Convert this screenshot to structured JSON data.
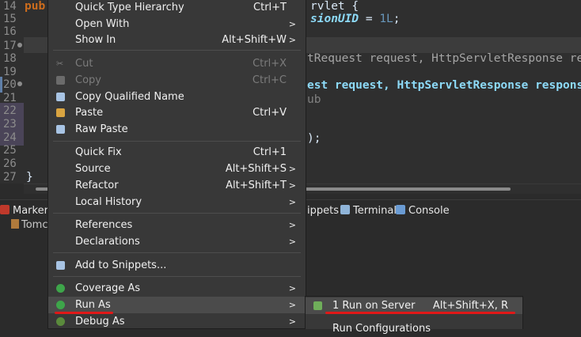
{
  "editor": {
    "gutter": [
      "14",
      "15",
      "16",
      "17",
      "18",
      "19",
      "20",
      "21",
      "22",
      "23",
      "24",
      "25",
      "26",
      "27"
    ],
    "code_lines": {
      "l14_kw": "pub",
      "l14_right": "rvlet {",
      "l15_field": "sionUID",
      "l15_rest": " = ",
      "l15_num": "1L",
      "l15_end": ";",
      "l18_text": "tRequest request, HttpServletResponse re",
      "l20_text": "est request, HttpServletResponse respons",
      "l21_text": "ub",
      "l24_text": ");",
      "l27_text": "}"
    }
  },
  "panel": {
    "tabs": [
      {
        "label": "Markers",
        "icon": "markers-icon"
      },
      {
        "label": "ippets",
        "icon": "snippets-icon"
      },
      {
        "label": "Terminal",
        "icon": "terminal-icon"
      },
      {
        "label": "Console",
        "icon": "console-icon"
      }
    ],
    "tree_item": "Tomc"
  },
  "context_menu": {
    "items": [
      {
        "label": "Quick Type Hierarchy",
        "accel": "Ctrl+T",
        "submenu": false,
        "disabled": false,
        "icon": ""
      },
      {
        "label": "Open With",
        "accel": "",
        "submenu": true,
        "disabled": false,
        "icon": ""
      },
      {
        "label": "Show In",
        "accel": "Alt+Shift+W",
        "submenu": true,
        "disabled": false,
        "icon": ""
      },
      {
        "label": "Cut",
        "accel": "Ctrl+X",
        "submenu": false,
        "disabled": true,
        "icon": "scissors-icon"
      },
      {
        "label": "Copy",
        "accel": "Ctrl+C",
        "submenu": false,
        "disabled": true,
        "icon": "copy-icon"
      },
      {
        "label": "Copy Qualified Name",
        "accel": "",
        "submenu": false,
        "disabled": false,
        "icon": "copy-qualified-icon"
      },
      {
        "label": "Paste",
        "accel": "Ctrl+V",
        "submenu": false,
        "disabled": false,
        "icon": "paste-icon"
      },
      {
        "label": "Raw Paste",
        "accel": "",
        "submenu": false,
        "disabled": false,
        "icon": "raw-paste-icon"
      },
      {
        "label": "Quick Fix",
        "accel": "Ctrl+1",
        "submenu": false,
        "disabled": false,
        "icon": ""
      },
      {
        "label": "Source",
        "accel": "Alt+Shift+S",
        "submenu": true,
        "disabled": false,
        "icon": ""
      },
      {
        "label": "Refactor",
        "accel": "Alt+Shift+T",
        "submenu": true,
        "disabled": false,
        "icon": ""
      },
      {
        "label": "Local History",
        "accel": "",
        "submenu": true,
        "disabled": false,
        "icon": ""
      },
      {
        "label": "References",
        "accel": "",
        "submenu": true,
        "disabled": false,
        "icon": ""
      },
      {
        "label": "Declarations",
        "accel": "",
        "submenu": true,
        "disabled": false,
        "icon": ""
      },
      {
        "label": "Add to Snippets...",
        "accel": "",
        "submenu": false,
        "disabled": false,
        "icon": "snippet-add-icon"
      },
      {
        "label": "Coverage As",
        "accel": "",
        "submenu": true,
        "disabled": false,
        "icon": "coverage-icon"
      },
      {
        "label": "Run As",
        "accel": "",
        "submenu": true,
        "disabled": false,
        "icon": "run-icon"
      },
      {
        "label": "Debug As",
        "accel": "",
        "submenu": true,
        "disabled": false,
        "icon": "debug-icon"
      }
    ]
  },
  "submenu": {
    "items": [
      {
        "label": "1 Run on Server",
        "accel": "Alt+Shift+X, R",
        "icon": "server-run-icon"
      },
      {
        "label": "Run Configurations",
        "accel": "",
        "icon": ""
      }
    ]
  },
  "colors": {
    "menu_bg": "#383838",
    "highlight": "#4b4b4b",
    "annotation_red": "#e01818"
  }
}
